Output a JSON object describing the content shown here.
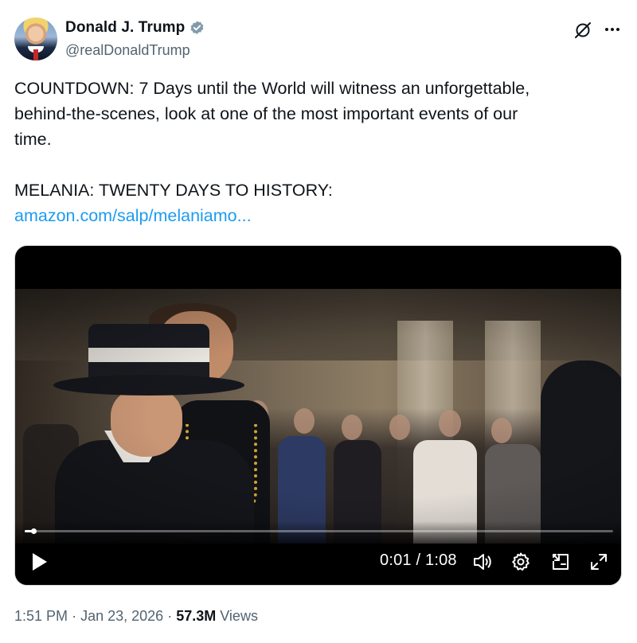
{
  "author": {
    "name": "Donald J. Trump",
    "handle": "@realDonaldTrump",
    "verified_color": "#829aab"
  },
  "tweet": {
    "line1": "COUNTDOWN: 7 Days until the World will witness an unforgettable,",
    "line2": "behind-the-scenes, look at one of the most important events of our",
    "line3": "time.",
    "line4": "MELANIA: TWENTY DAYS TO HISTORY:",
    "link": "amazon.com/salp/melaniamo..."
  },
  "video": {
    "current_time": "0:01",
    "separator": "/",
    "duration": "1:08",
    "progress_fraction": 0.015,
    "time_display": "0:01 / 1:08"
  },
  "meta": {
    "time": "1:51 PM",
    "date": "Jan 23, 2026",
    "dot": "·",
    "views_count": "57.3M",
    "views_label": "Views"
  },
  "icons": {
    "grok": "grok-icon",
    "more": "more-icon",
    "play": "play-icon",
    "volume": "volume-icon",
    "settings": "settings-gear-icon",
    "pip": "picture-in-picture-icon",
    "fullscreen": "fullscreen-icon"
  },
  "colors": {
    "link": "#1d9bf0",
    "secondary_text": "#536471",
    "primary_text": "#0f1419"
  }
}
